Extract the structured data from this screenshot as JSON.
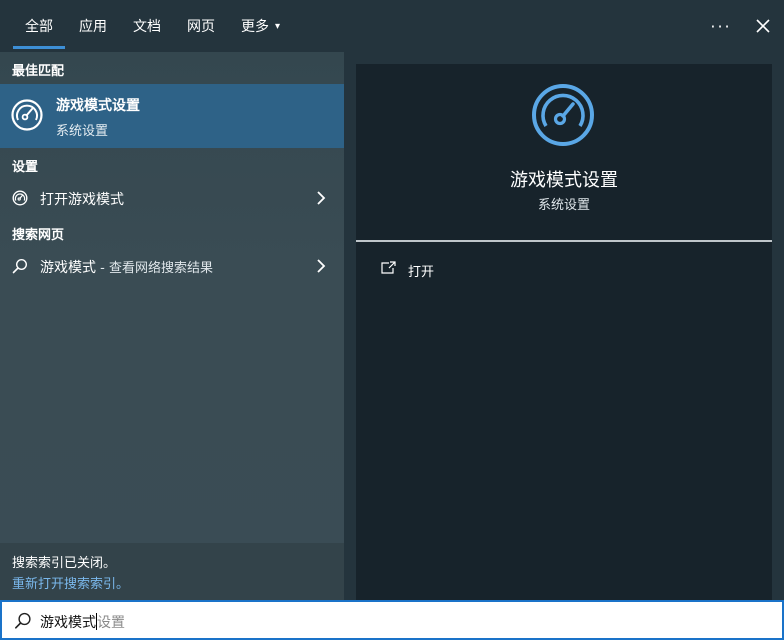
{
  "header": {
    "tabs": [
      {
        "label": "全部",
        "active": true
      },
      {
        "label": "应用",
        "active": false
      },
      {
        "label": "文档",
        "active": false
      },
      {
        "label": "网页",
        "active": false
      },
      {
        "label": "更多",
        "active": false
      }
    ],
    "more_caret": "▾",
    "options_glyph": "···",
    "close_glyph": "✕"
  },
  "sections": {
    "best_match": "最佳匹配",
    "settings": "设置",
    "web": "搜索网页"
  },
  "best_match": {
    "title": "游戏模式设置",
    "subtitle": "系统设置",
    "icon": "gauge-icon"
  },
  "settings_items": [
    {
      "label": "打开游戏模式",
      "icon": "gauge-icon"
    }
  ],
  "web_items": [
    {
      "label": "游戏模式",
      "hint": " - 查看网络搜索结果",
      "icon": "search-icon"
    }
  ],
  "index_notice": {
    "line1": "搜索索引已关闭。",
    "line2": "重新打开搜索索引。"
  },
  "preview": {
    "title": "游戏模式设置",
    "subtitle": "系统设置",
    "icon": "gauge-icon",
    "actions": [
      {
        "label": "打开",
        "icon": "open-icon"
      }
    ]
  },
  "search": {
    "typed": "游戏模式",
    "suggestion": "设置"
  },
  "colors": {
    "accent": "#3d8fd6",
    "selection": "#2e6287",
    "link": "#7ab8ec",
    "icon_blue": "#5aa7e6"
  }
}
